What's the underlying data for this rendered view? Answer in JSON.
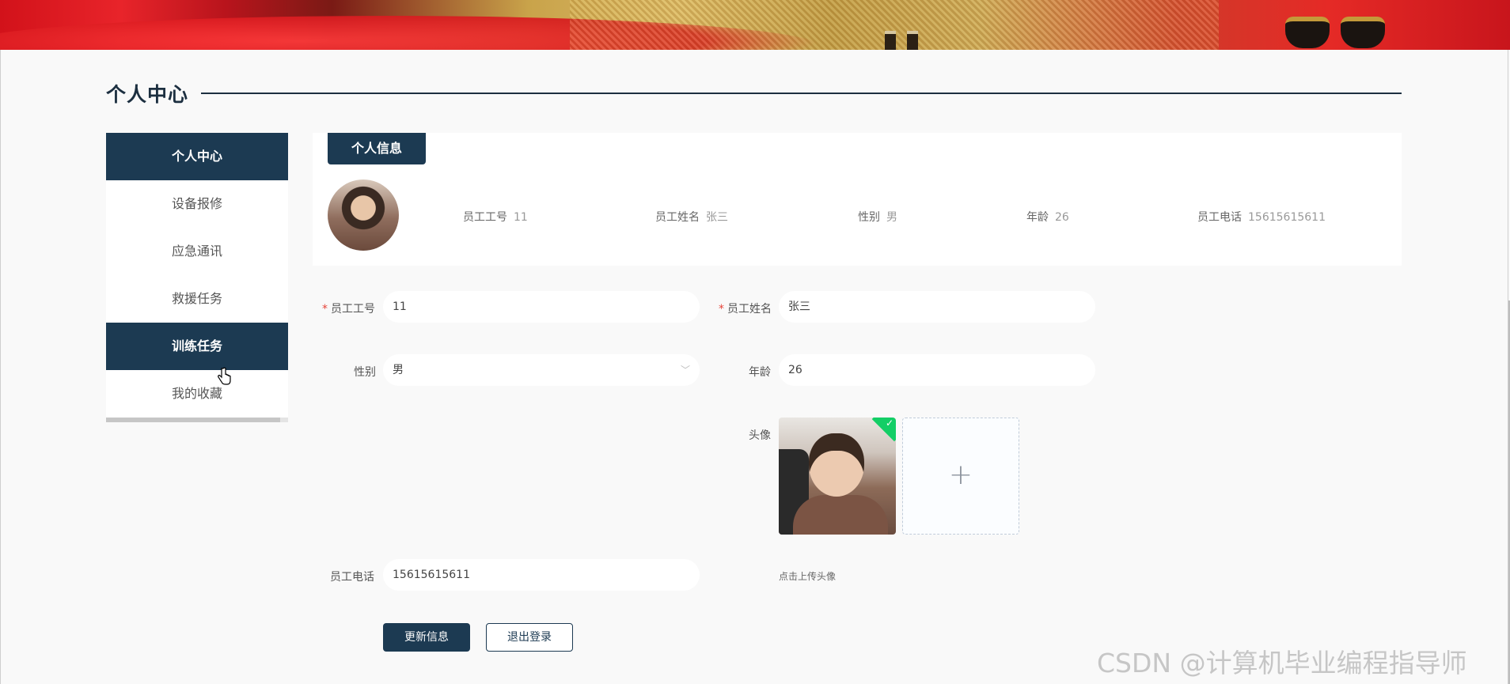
{
  "page": {
    "title": "个人中心"
  },
  "sidebar": {
    "items": [
      {
        "label": "个人中心",
        "active": true
      },
      {
        "label": "设备报修",
        "active": false
      },
      {
        "label": "应急通讯",
        "active": false
      },
      {
        "label": "救援任务",
        "active": false
      },
      {
        "label": "训练任务",
        "active": true
      },
      {
        "label": "我的收藏",
        "active": false
      }
    ]
  },
  "info": {
    "tab_label": "个人信息",
    "fields": [
      {
        "key": "员工工号",
        "value": "11"
      },
      {
        "key": "员工姓名",
        "value": "张三"
      },
      {
        "key": "性别",
        "value": "男"
      },
      {
        "key": "年龄",
        "value": "26"
      },
      {
        "key": "员工电话",
        "value": "15615615611"
      }
    ]
  },
  "form": {
    "id_label": "员工工号",
    "id_value": "11",
    "name_label": "员工姓名",
    "name_value": "张三",
    "gender_label": "性别",
    "gender_value": "男",
    "age_label": "年龄",
    "age_value": "26",
    "avatar_label": "头像",
    "upload_tip": "点击上传头像",
    "upload_plus": "+",
    "phone_label": "员工电话",
    "phone_value": "15615615611",
    "required_mark": "*",
    "select_arrow": "﹀"
  },
  "buttons": {
    "update": "更新信息",
    "logout": "退出登录"
  },
  "watermark": "CSDN @计算机毕业编程指导师",
  "colors": {
    "primary": "#1c3a52",
    "success": "#13ce66",
    "required": "#e6443a"
  }
}
